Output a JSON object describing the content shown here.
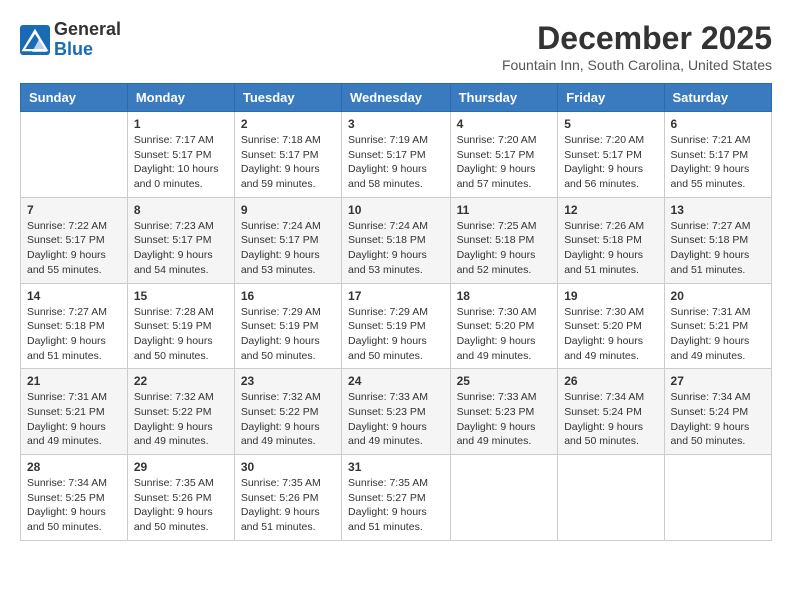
{
  "logo": {
    "general": "General",
    "blue": "Blue"
  },
  "header": {
    "month": "December 2025",
    "location": "Fountain Inn, South Carolina, United States"
  },
  "weekdays": [
    "Sunday",
    "Monday",
    "Tuesday",
    "Wednesday",
    "Thursday",
    "Friday",
    "Saturday"
  ],
  "weeks": [
    [
      {
        "day": "",
        "info": ""
      },
      {
        "day": "1",
        "info": "Sunrise: 7:17 AM\nSunset: 5:17 PM\nDaylight: 10 hours\nand 0 minutes."
      },
      {
        "day": "2",
        "info": "Sunrise: 7:18 AM\nSunset: 5:17 PM\nDaylight: 9 hours\nand 59 minutes."
      },
      {
        "day": "3",
        "info": "Sunrise: 7:19 AM\nSunset: 5:17 PM\nDaylight: 9 hours\nand 58 minutes."
      },
      {
        "day": "4",
        "info": "Sunrise: 7:20 AM\nSunset: 5:17 PM\nDaylight: 9 hours\nand 57 minutes."
      },
      {
        "day": "5",
        "info": "Sunrise: 7:20 AM\nSunset: 5:17 PM\nDaylight: 9 hours\nand 56 minutes."
      },
      {
        "day": "6",
        "info": "Sunrise: 7:21 AM\nSunset: 5:17 PM\nDaylight: 9 hours\nand 55 minutes."
      }
    ],
    [
      {
        "day": "7",
        "info": "Sunrise: 7:22 AM\nSunset: 5:17 PM\nDaylight: 9 hours\nand 55 minutes."
      },
      {
        "day": "8",
        "info": "Sunrise: 7:23 AM\nSunset: 5:17 PM\nDaylight: 9 hours\nand 54 minutes."
      },
      {
        "day": "9",
        "info": "Sunrise: 7:24 AM\nSunset: 5:17 PM\nDaylight: 9 hours\nand 53 minutes."
      },
      {
        "day": "10",
        "info": "Sunrise: 7:24 AM\nSunset: 5:18 PM\nDaylight: 9 hours\nand 53 minutes."
      },
      {
        "day": "11",
        "info": "Sunrise: 7:25 AM\nSunset: 5:18 PM\nDaylight: 9 hours\nand 52 minutes."
      },
      {
        "day": "12",
        "info": "Sunrise: 7:26 AM\nSunset: 5:18 PM\nDaylight: 9 hours\nand 51 minutes."
      },
      {
        "day": "13",
        "info": "Sunrise: 7:27 AM\nSunset: 5:18 PM\nDaylight: 9 hours\nand 51 minutes."
      }
    ],
    [
      {
        "day": "14",
        "info": "Sunrise: 7:27 AM\nSunset: 5:18 PM\nDaylight: 9 hours\nand 51 minutes."
      },
      {
        "day": "15",
        "info": "Sunrise: 7:28 AM\nSunset: 5:19 PM\nDaylight: 9 hours\nand 50 minutes."
      },
      {
        "day": "16",
        "info": "Sunrise: 7:29 AM\nSunset: 5:19 PM\nDaylight: 9 hours\nand 50 minutes."
      },
      {
        "day": "17",
        "info": "Sunrise: 7:29 AM\nSunset: 5:19 PM\nDaylight: 9 hours\nand 50 minutes."
      },
      {
        "day": "18",
        "info": "Sunrise: 7:30 AM\nSunset: 5:20 PM\nDaylight: 9 hours\nand 49 minutes."
      },
      {
        "day": "19",
        "info": "Sunrise: 7:30 AM\nSunset: 5:20 PM\nDaylight: 9 hours\nand 49 minutes."
      },
      {
        "day": "20",
        "info": "Sunrise: 7:31 AM\nSunset: 5:21 PM\nDaylight: 9 hours\nand 49 minutes."
      }
    ],
    [
      {
        "day": "21",
        "info": "Sunrise: 7:31 AM\nSunset: 5:21 PM\nDaylight: 9 hours\nand 49 minutes."
      },
      {
        "day": "22",
        "info": "Sunrise: 7:32 AM\nSunset: 5:22 PM\nDaylight: 9 hours\nand 49 minutes."
      },
      {
        "day": "23",
        "info": "Sunrise: 7:32 AM\nSunset: 5:22 PM\nDaylight: 9 hours\nand 49 minutes."
      },
      {
        "day": "24",
        "info": "Sunrise: 7:33 AM\nSunset: 5:23 PM\nDaylight: 9 hours\nand 49 minutes."
      },
      {
        "day": "25",
        "info": "Sunrise: 7:33 AM\nSunset: 5:23 PM\nDaylight: 9 hours\nand 49 minutes."
      },
      {
        "day": "26",
        "info": "Sunrise: 7:34 AM\nSunset: 5:24 PM\nDaylight: 9 hours\nand 50 minutes."
      },
      {
        "day": "27",
        "info": "Sunrise: 7:34 AM\nSunset: 5:24 PM\nDaylight: 9 hours\nand 50 minutes."
      }
    ],
    [
      {
        "day": "28",
        "info": "Sunrise: 7:34 AM\nSunset: 5:25 PM\nDaylight: 9 hours\nand 50 minutes."
      },
      {
        "day": "29",
        "info": "Sunrise: 7:35 AM\nSunset: 5:26 PM\nDaylight: 9 hours\nand 50 minutes."
      },
      {
        "day": "30",
        "info": "Sunrise: 7:35 AM\nSunset: 5:26 PM\nDaylight: 9 hours\nand 51 minutes."
      },
      {
        "day": "31",
        "info": "Sunrise: 7:35 AM\nSunset: 5:27 PM\nDaylight: 9 hours\nand 51 minutes."
      },
      {
        "day": "",
        "info": ""
      },
      {
        "day": "",
        "info": ""
      },
      {
        "day": "",
        "info": ""
      }
    ]
  ]
}
